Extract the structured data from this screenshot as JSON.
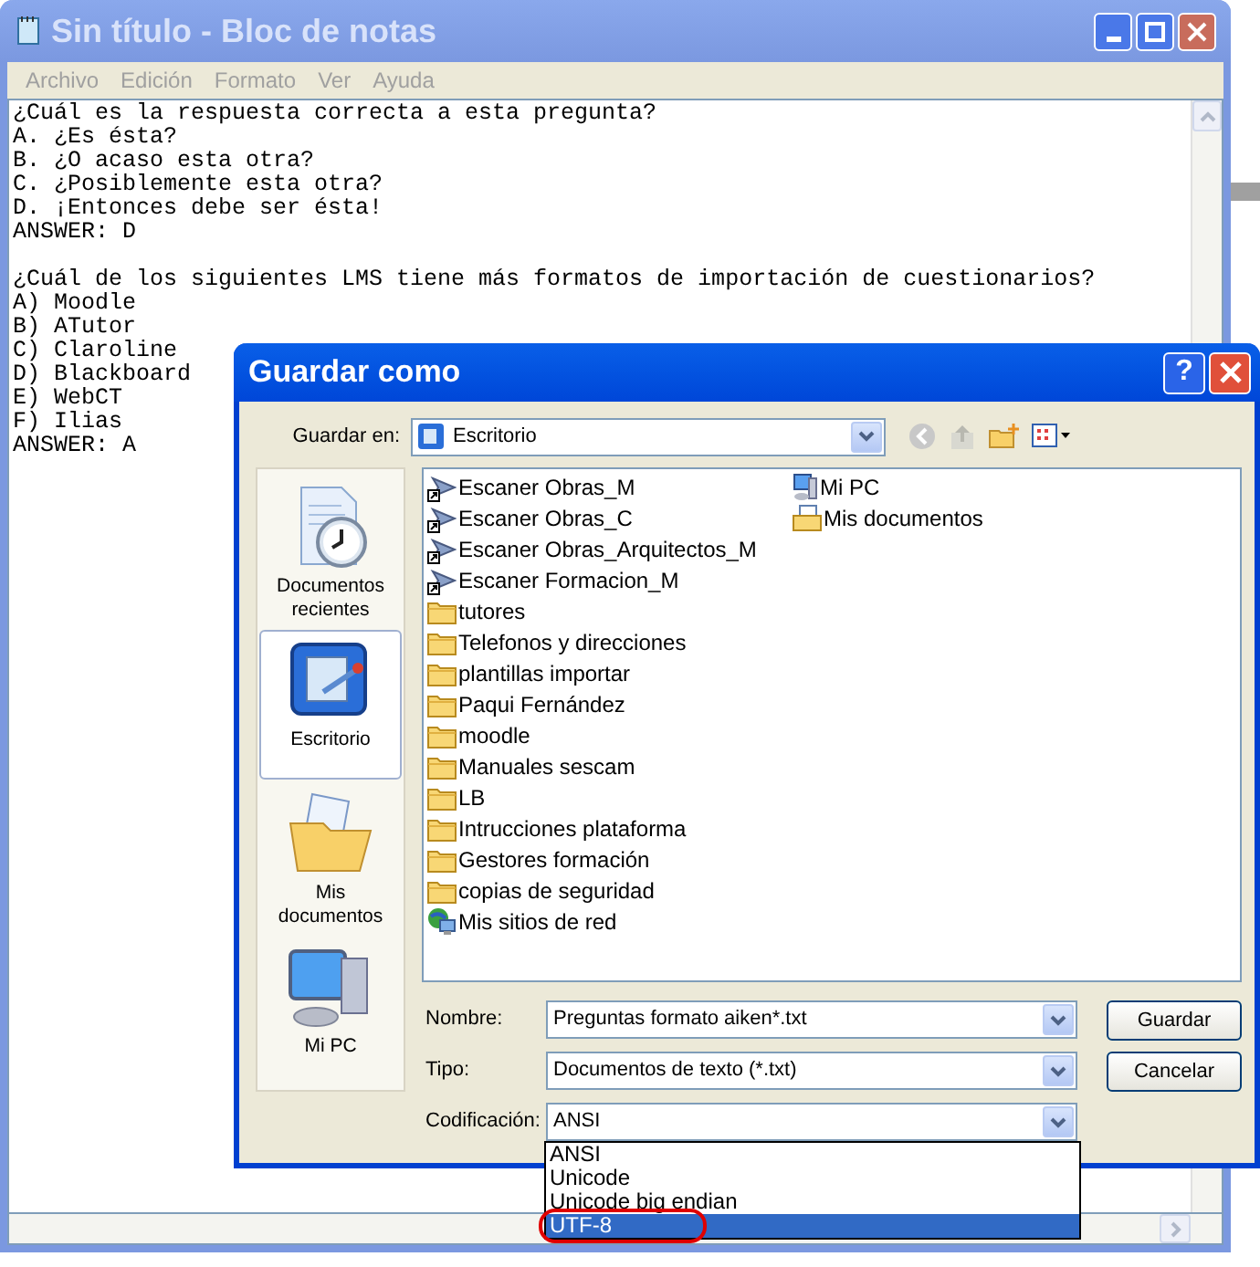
{
  "notepad": {
    "title": "Sin título - Bloc de notas",
    "active": false,
    "menu": [
      "Archivo",
      "Edición",
      "Formato",
      "Ver",
      "Ayuda"
    ],
    "blocks": [
      [
        "¿Cuál es la respuesta correcta a esta pregunta?",
        "A. ¿Es ésta?",
        "B. ¿O acaso esta otra?",
        "C. ¿Posiblemente esta otra?",
        "D. ¡Entonces debe ser ésta!",
        "ANSWER: D"
      ],
      [
        "¿Cuál de los siguientes LMS tiene más formatos de importación de cuestionarios?",
        "A) Moodle",
        "B) ATutor",
        "C) Claroline",
        "D) Blackboard",
        "E) WebCT",
        "F) Ilias",
        "ANSWER: A"
      ]
    ]
  },
  "dialog": {
    "title": "Guardar como",
    "active": true,
    "title_buttons": [
      "?"
    ],
    "save_in": {
      "label": "Guardar en:",
      "value": "Escritorio"
    },
    "places": [
      {
        "label": "Documentos recientes",
        "kind": "recent",
        "selected": false
      },
      {
        "label": "Escritorio",
        "kind": "desktop",
        "selected": true
      },
      {
        "label": "Mis documentos",
        "kind": "documents",
        "selected": false
      },
      {
        "label": "Mi PC",
        "kind": "computer",
        "selected": false
      }
    ],
    "files": [
      {
        "name": "Escaner Obras_M",
        "kind": "shortcut"
      },
      {
        "name": "Escaner Obras_C",
        "kind": "shortcut"
      },
      {
        "name": "Escaner Obras_Arquitectos_M",
        "kind": "shortcut"
      },
      {
        "name": "Escaner Formacion_M",
        "kind": "shortcut"
      },
      {
        "name": "tutores",
        "kind": "folder"
      },
      {
        "name": "Telefonos y direcciones",
        "kind": "folder"
      },
      {
        "name": "plantillas importar",
        "kind": "folder"
      },
      {
        "name": "Paqui Fernández",
        "kind": "folder"
      },
      {
        "name": "moodle",
        "kind": "folder"
      },
      {
        "name": "Manuales sescam",
        "kind": "folder"
      },
      {
        "name": "LB",
        "kind": "folder"
      },
      {
        "name": "Intrucciones plataforma",
        "kind": "folder"
      },
      {
        "name": "Gestores formación",
        "kind": "folder"
      },
      {
        "name": "copias de seguridad",
        "kind": "folder"
      },
      {
        "name": "Mis sitios de red",
        "kind": "network"
      },
      {
        "name": "Mi PC",
        "kind": "computer"
      },
      {
        "name": "Mis documentos",
        "kind": "documents"
      }
    ],
    "fields": [
      {
        "label": "Nombre:",
        "value": "Preguntas formato aiken*.txt"
      },
      {
        "label": "Tipo:",
        "value": "Documentos de texto (*.txt)"
      },
      {
        "label": "Codificación:",
        "value": "ANSI"
      }
    ],
    "buttons": [
      "Guardar",
      "Cancelar"
    ],
    "encoding_options": [
      {
        "label": "ANSI",
        "selected": false,
        "circled": false
      },
      {
        "label": "Unicode",
        "selected": false,
        "circled": false
      },
      {
        "label": "Unicode big endian",
        "selected": false,
        "circled": false
      },
      {
        "label": "UTF-8",
        "selected": true,
        "circled": true
      }
    ]
  }
}
